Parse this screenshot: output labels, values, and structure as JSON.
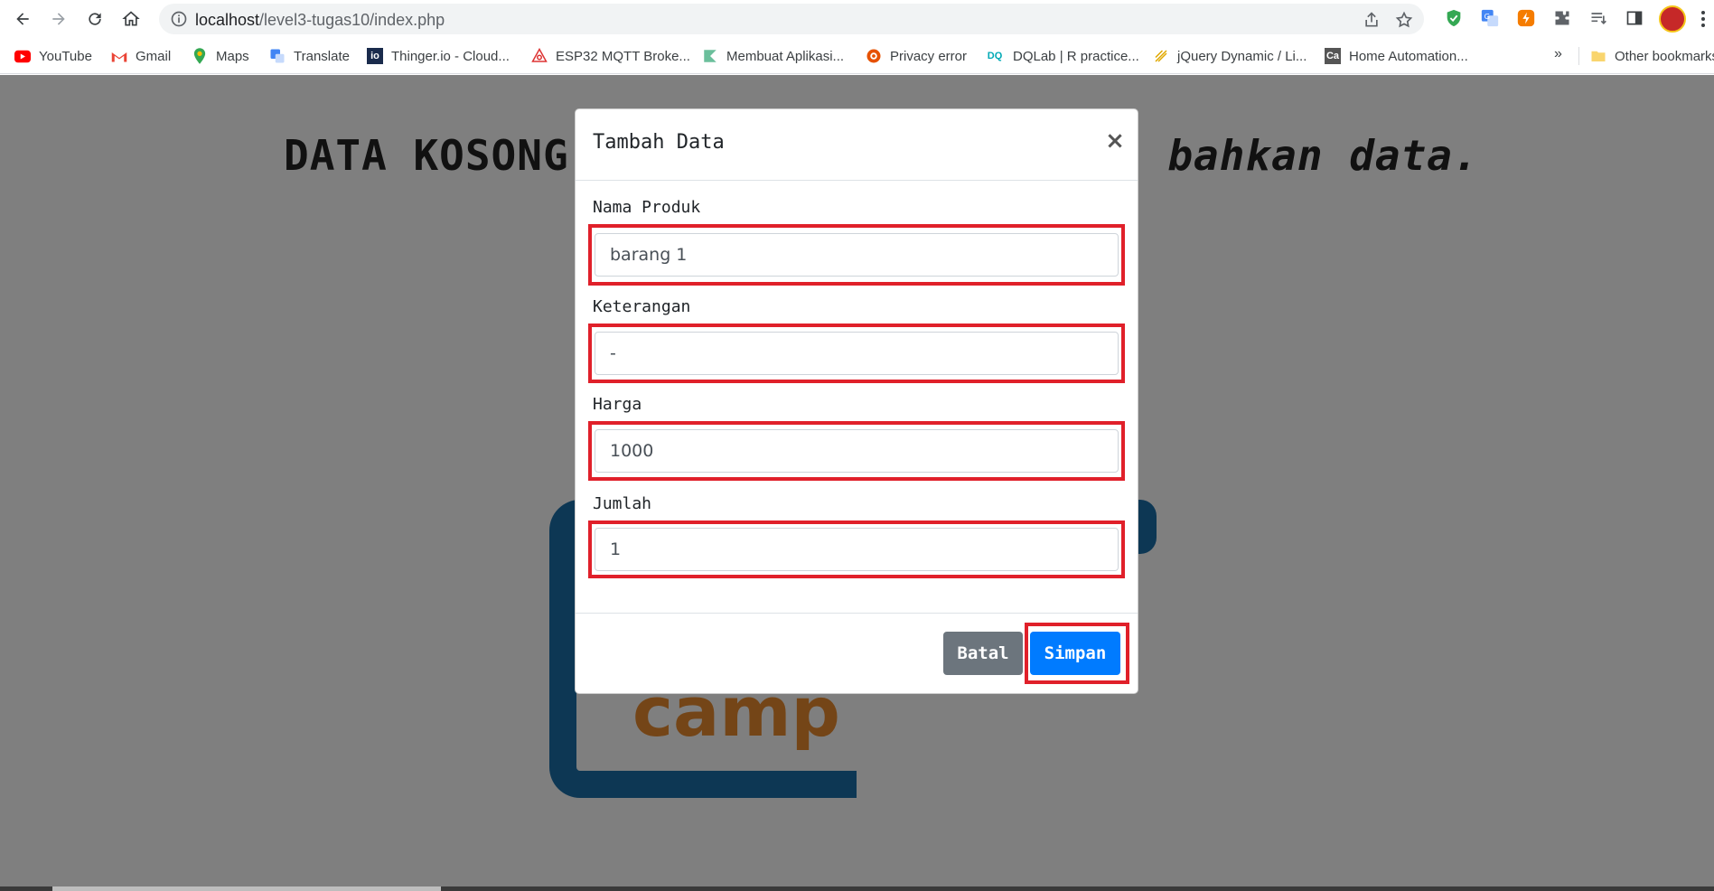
{
  "browser": {
    "url_host": "localhost",
    "url_path": "/level3-tugas10/index.php",
    "bookmarks": [
      {
        "label": "YouTube",
        "icon": "youtube-icon",
        "color": "#ff0000"
      },
      {
        "label": "Gmail",
        "icon": "gmail-icon",
        "color": "#ea4335"
      },
      {
        "label": "Maps",
        "icon": "maps-icon",
        "color": "#34a853"
      },
      {
        "label": "Translate",
        "icon": "translate-icon",
        "color": "#4285f4"
      },
      {
        "label": "Thinger.io - Cloud...",
        "icon": "thinger-icon",
        "color": "#1a2b4c"
      },
      {
        "label": "ESP32 MQTT Broke...",
        "icon": "mqtt-icon",
        "color": "#d33"
      },
      {
        "label": "Membuat Aplikasi...",
        "icon": "kotlin-icon",
        "color": "#6bbf9c"
      },
      {
        "label": "Privacy error",
        "icon": "privacy-error-icon",
        "color": "#e65100"
      },
      {
        "label": "DQLab | R practice...",
        "icon": "dqlab-icon",
        "color": "#00a9b5"
      },
      {
        "label": "jQuery Dynamic / Li...",
        "icon": "jquery-icon",
        "color": "#e0a800"
      },
      {
        "label": "Home Automation...",
        "icon": "home-automation-icon",
        "color": "#555"
      }
    ],
    "bookmarks_more": "»",
    "other_bookmarks": "Other bookmarks"
  },
  "page": {
    "empty_message_start": "DATA KOSONG!",
    "empty_message_end": "bahkan data.",
    "logo_word": "camp"
  },
  "modal": {
    "title": "Tambah Data",
    "close_label": "×",
    "fields": [
      {
        "label": "Nama Produk",
        "value": "barang 1"
      },
      {
        "label": "Keterangan",
        "value": "-"
      },
      {
        "label": "Harga",
        "value": "1000"
      },
      {
        "label": "Jumlah",
        "value": "1"
      }
    ],
    "cancel_label": "Batal",
    "save_label": "Simpan"
  },
  "colors": {
    "highlight": "#e0202a",
    "primary": "#007bff",
    "secondary": "#6c757d"
  }
}
